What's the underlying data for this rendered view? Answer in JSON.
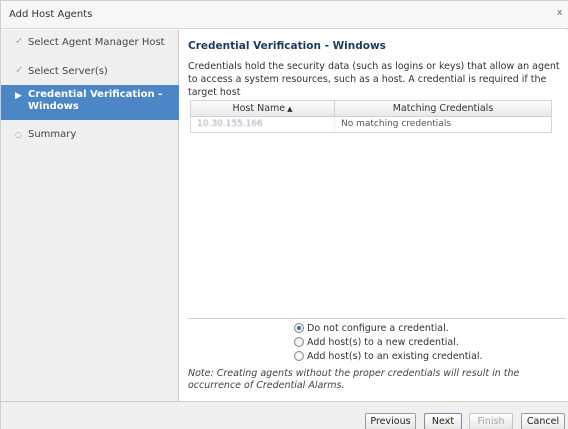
{
  "window": {
    "title": "Add Host Agents",
    "close_glyph": "x"
  },
  "sidebar": {
    "steps": [
      {
        "label": "Select Agent Manager Host",
        "state": "done",
        "mark": "✓"
      },
      {
        "label": "Select Server(s)",
        "state": "done",
        "mark": "✓"
      },
      {
        "label_line1": "Credential Verification -",
        "label_line2": "Windows",
        "state": "active",
        "mark": "▶"
      },
      {
        "label": "Summary",
        "state": "pending",
        "mark": "○"
      }
    ]
  },
  "main": {
    "title": "Credential Verification - Windows",
    "description": "Credentials hold the security data (such as logins or keys) that allow an agent to access a system resources, such as a host. A credential is required if the target host",
    "table": {
      "columns": [
        {
          "label": "Host Name",
          "sorted": "ascending",
          "icon": "sort-ascending-icon"
        },
        {
          "label": "Matching Credentials"
        }
      ],
      "rows": [
        {
          "host": "10.30.155.166",
          "credentials": "No matching credentials"
        }
      ]
    },
    "options": [
      {
        "label": "Do not configure a credential.",
        "checked": true
      },
      {
        "label": "Add host(s) to a new credential.",
        "checked": false
      },
      {
        "label": "Add host(s) to an existing credential.",
        "checked": false
      }
    ],
    "note": "Note: Creating agents without the proper credentials will result in the occurrence of Credential Alarms."
  },
  "footer": {
    "previous_label": "Previous",
    "next_label": "Next",
    "finish_label": "Finish",
    "cancel_label": "Cancel"
  },
  "colors": {
    "accent": "#4d86c7",
    "title_text": "#1f3b5c"
  }
}
